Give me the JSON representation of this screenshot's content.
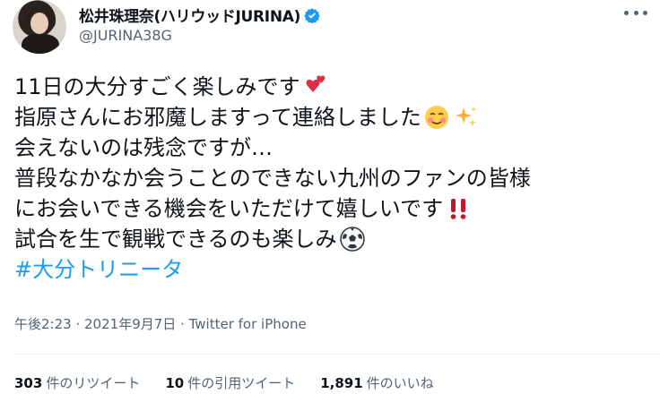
{
  "author": {
    "display_name": "松井珠理奈(ハリウッドJURINA)",
    "handle": "@JURINA38G"
  },
  "tweet": {
    "lines": [
      "11日の大分すごく楽しみです",
      "指原さんにお邪魔しますって連絡しました",
      "会えないのは残念ですが…",
      "普段なかなか会うことのできない九州のファンの皆様",
      "にお会いできる機会をいただけて嬉しいです",
      "試合を生で観戦できるのも楽しみ",
      "#大分トリニータ"
    ],
    "emojis": [
      "two-hearts",
      "smiling-face",
      "sparkles",
      "double-exclamation",
      "soccer-ball"
    ]
  },
  "meta": {
    "time": "午後2:23",
    "date": "2021年9月7日",
    "source": "Twitter for iPhone"
  },
  "stats": {
    "retweets_count": "303",
    "retweets_label": "件のリツイート",
    "quotes_count": "10",
    "quotes_label": "件の引用ツイート",
    "likes_count": "1,891",
    "likes_label": "件のいいね"
  },
  "colors": {
    "text": "#0f1419",
    "secondary": "#536471",
    "link": "#1d9bf0",
    "verified": "#1d9bf0"
  }
}
